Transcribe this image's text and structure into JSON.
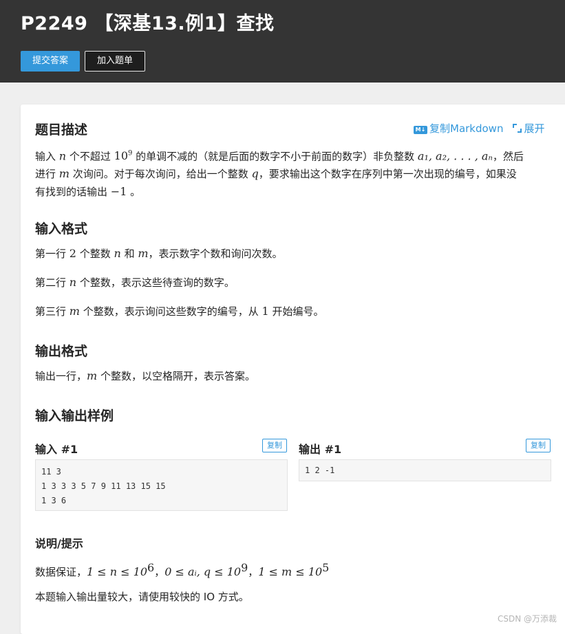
{
  "header": {
    "title": "P2249 【深基13.例1】查找",
    "submit_label": "提交答案",
    "add_label": "加入题单"
  },
  "actions": {
    "markdown_badge": "M↓",
    "copy_markdown_label": "复制Markdown",
    "expand_label": "展开"
  },
  "description": {
    "heading": "题目描述",
    "line1_a": "输入 ",
    "line1_n": "n",
    "line1_b": " 个不超过 ",
    "line1_base": "10",
    "line1_exp": "9",
    "line1_c": " 的单调不减的（就是后面的数字不小于前面的数字）非负整数 ",
    "line1_seq": "a₁, a₂, . . . , aₙ",
    "line1_d": "，然后",
    "line2_a": "进行 ",
    "line2_m": "m",
    "line2_b": " 次询问。对于每次询问，给出一个整数 ",
    "line2_q": "q",
    "line2_c": "，要求输出这个数字在序列中第一次出现的编号，如果没",
    "line3_a": "有找到的话输出 ",
    "line3_neg": "−1",
    "line3_b": " 。"
  },
  "input_format": {
    "heading": "输入格式",
    "l1_a": "第一行 ",
    "l1_num": "2",
    "l1_b": " 个整数 ",
    "l1_n": "n",
    "l1_c": " 和 ",
    "l1_m": "m",
    "l1_d": "，表示数字个数和询问次数。",
    "l2_a": "第二行 ",
    "l2_n": "n",
    "l2_b": " 个整数，表示这些待查询的数字。",
    "l3_a": "第三行 ",
    "l3_m": "m",
    "l3_b": " 个整数，表示询问这些数字的编号，从 ",
    "l3_one": "1",
    "l3_c": " 开始编号。"
  },
  "output_format": {
    "heading": "输出格式",
    "l1_a": "输出一行，",
    "l1_m": "m",
    "l1_b": " 个整数，以空格隔开，表示答案。"
  },
  "samples": {
    "heading": "输入输出样例",
    "input_label": "输入 #1",
    "output_label": "输出 #1",
    "copy_label": "复制",
    "input_line1": "11 3",
    "input_line2": "1 3 3 3 5 7 9 11 13 15 15",
    "input_line3": "1 3 6",
    "output_line1": "1 2 -1"
  },
  "hint": {
    "heading": "说明/提示",
    "l1_a": "数据保证，",
    "c1": "1 ≤ n ≤ 10",
    "c1_exp": "6",
    "c2": "0 ≤ aᵢ, q ≤ 10",
    "c2_exp": "9",
    "c3": "1 ≤ m ≤ 10",
    "c3_exp": "5",
    "sep": "，",
    "l2": "本题输入输出量较大，请使用较快的 IO 方式。"
  },
  "watermark": "CSDN @万添裁"
}
